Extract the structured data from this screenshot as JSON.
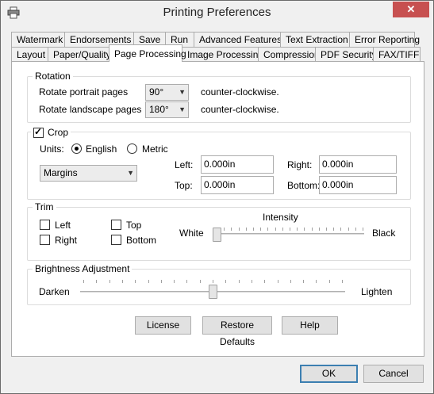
{
  "window": {
    "title": "Printing Preferences",
    "close_glyph": "✕"
  },
  "tabs": {
    "row1": [
      "Watermark",
      "Endorsements",
      "Save",
      "Run",
      "Advanced Features",
      "Text Extraction",
      "Error Reporting"
    ],
    "row2": [
      "Layout",
      "Paper/Quality",
      "Page Processing",
      "Image Processing",
      "Compression",
      "PDF Security",
      "FAX/TIFF"
    ],
    "active": "Page Processing"
  },
  "rotation": {
    "label": "Rotation",
    "portrait_label": "Rotate portrait pages",
    "portrait_value": "90°",
    "landscape_label": "Rotate landscape pages",
    "landscape_value": "180°",
    "direction_text": "counter-clockwise."
  },
  "crop": {
    "label": "Crop",
    "checked": true,
    "units_label": "Units:",
    "english_label": "English",
    "metric_label": "Metric",
    "selected_unit": "English",
    "mode_value": "Margins",
    "left_label": "Left:",
    "left_value": "0.000in",
    "right_label": "Right:",
    "right_value": "0.000in",
    "top_label": "Top:",
    "top_value": "0.000in",
    "bottom_label": "Bottom:",
    "bottom_value": "0.000in"
  },
  "trim": {
    "label": "Trim",
    "left_label": "Left",
    "top_label": "Top",
    "right_label": "Right",
    "bottom_label": "Bottom",
    "intensity_label": "Intensity",
    "white_label": "White",
    "black_label": "Black",
    "intensity_level": 0
  },
  "brightness": {
    "label": "Brightness Adjustment",
    "darken_label": "Darken",
    "lighten_label": "Lighten",
    "level": 0.5
  },
  "panel_buttons": {
    "license": "License",
    "restore": "Restore Defaults",
    "help": "Help"
  },
  "dialog_buttons": {
    "ok": "OK",
    "cancel": "Cancel"
  },
  "colors": {
    "close_button": "#c75050",
    "default_button_border": "#3c7fb1"
  }
}
